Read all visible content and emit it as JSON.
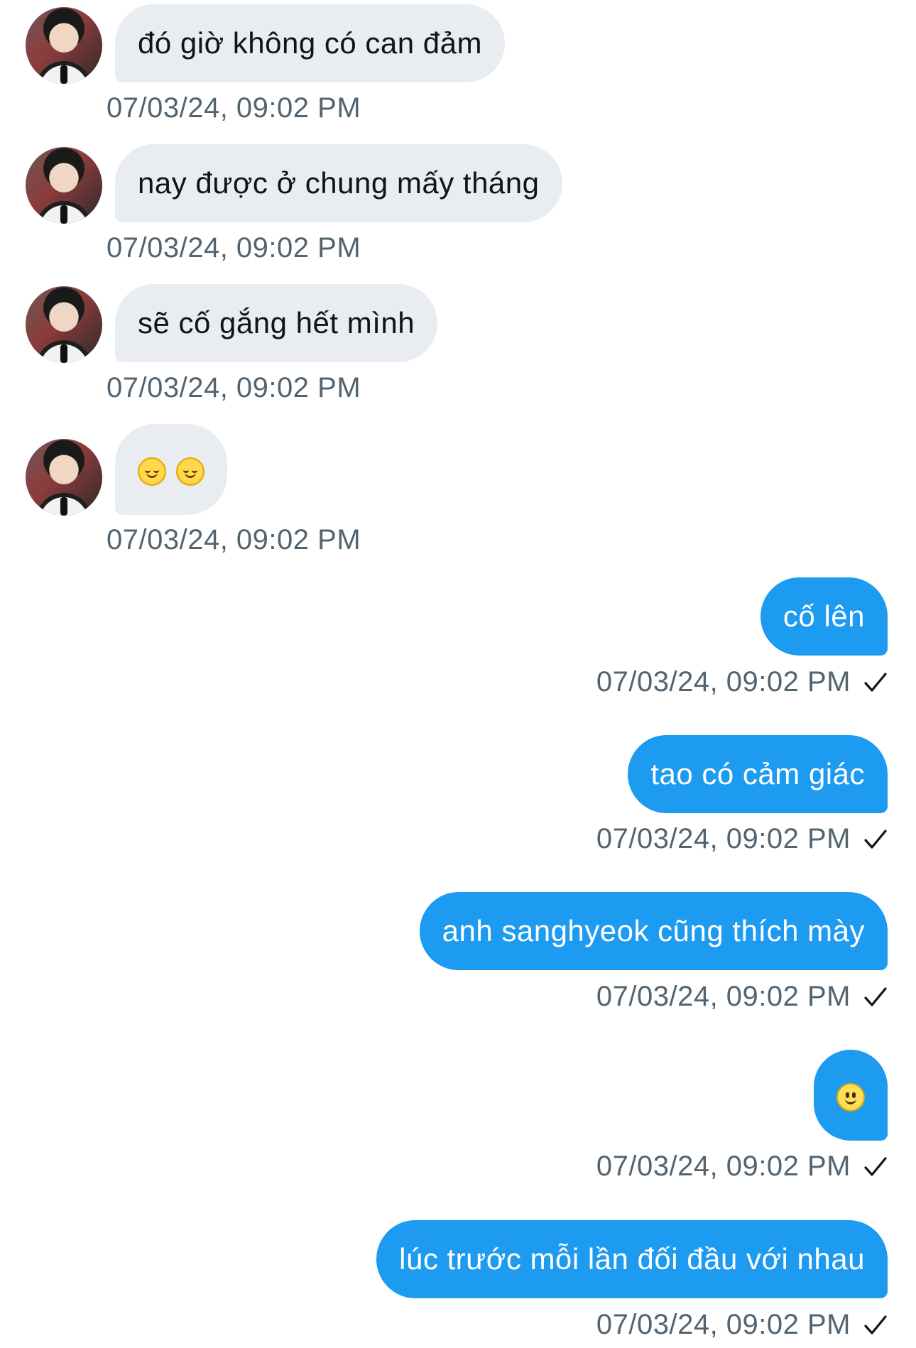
{
  "messages": {
    "incoming": [
      {
        "text": "đó giờ không có can đảm",
        "time": "07/03/24, 09:02 PM"
      },
      {
        "text": "nay được ở chung mấy tháng",
        "time": "07/03/24, 09:02 PM"
      },
      {
        "text": "sẽ cố gắng hết mình",
        "time": "07/03/24, 09:02 PM"
      },
      {
        "emojis": [
          "smiling-face-icon",
          "smiling-face-icon"
        ],
        "time": "07/03/24, 09:02 PM"
      }
    ],
    "outgoing": [
      {
        "text": "cố lên",
        "time": "07/03/24, 09:02 PM",
        "status_icon": "checkmark-icon"
      },
      {
        "text": "tao có cảm giác",
        "time": "07/03/24, 09:02 PM",
        "status_icon": "checkmark-icon"
      },
      {
        "text": "anh sanghyeok cũng thích mày",
        "time": "07/03/24, 09:02 PM",
        "status_icon": "checkmark-icon"
      },
      {
        "emojis": [
          "slightly-smiling-face-icon"
        ],
        "time": "07/03/24, 09:02 PM",
        "status_icon": "checkmark-icon"
      },
      {
        "text": "lúc trước mỗi lần đối đầu với nhau",
        "time": "07/03/24, 09:02 PM",
        "status_icon": "checkmark-icon"
      }
    ]
  },
  "colors": {
    "incoming_bubble": "#e9edf1",
    "outgoing_bubble": "#1d9bf0",
    "timestamp": "#536471",
    "text_dark": "#0f1419"
  }
}
